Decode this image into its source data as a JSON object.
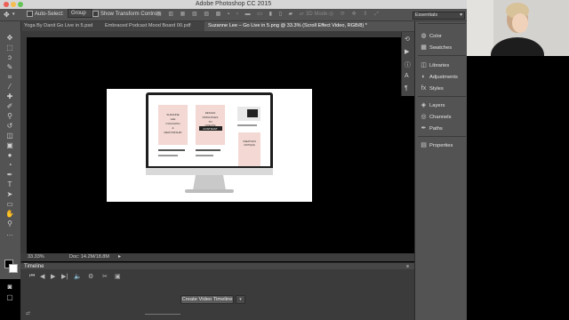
{
  "app": {
    "title": "Adobe Photoshop CC 2015"
  },
  "options": {
    "auto_select_label": "Auto-Select:",
    "auto_select_value": "Group",
    "show_transform_label": "Show Transform Controls",
    "mode_3d": "3D Mode:"
  },
  "workspace": {
    "value": "Essentials"
  },
  "tabs": [
    {
      "label": "Yoga By Danit Go Live in 5.psd"
    },
    {
      "label": "Embraced Podcast Mood Board 00.pdf"
    },
    {
      "label": "Suzanne Lee – Go Live in 5.png @ 33.3% (Scroll Effect Video, RGB/8) *"
    }
  ],
  "status": {
    "zoom": "33.33%",
    "doc": "Doc: 14.2M/18.8M"
  },
  "timeline": {
    "title": "Timeline",
    "create_button": "Create Video Timeline"
  },
  "document": {
    "card1": {
      "line1": "SUZANNE",
      "line2": "LEE",
      "line3": "COACHING",
      "line4": "&",
      "line5": "MENTORSHIP"
    },
    "card2": {
      "line1": "DESIGN",
      "line2": "PRINCIPLES",
      "line3": "TO",
      "line4": "CREATE",
      "line5": "CONTRAST"
    },
    "card3": {
      "line1": "CREATIVE'S",
      "line2": "CRITIQUE"
    }
  },
  "panels": [
    {
      "label": "Color",
      "icon": "color-wheel-icon"
    },
    {
      "label": "Swatches",
      "icon": "swatches-grid-icon"
    },
    {
      "label": "Libraries",
      "icon": "library-icon"
    },
    {
      "label": "Adjustments",
      "icon": "adjustments-icon"
    },
    {
      "label": "Styles",
      "icon": "styles-icon"
    },
    {
      "label": "Layers",
      "icon": "layers-icon"
    },
    {
      "label": "Channels",
      "icon": "channels-icon"
    },
    {
      "label": "Paths",
      "icon": "paths-icon"
    },
    {
      "label": "Properties",
      "icon": "properties-icon"
    }
  ]
}
